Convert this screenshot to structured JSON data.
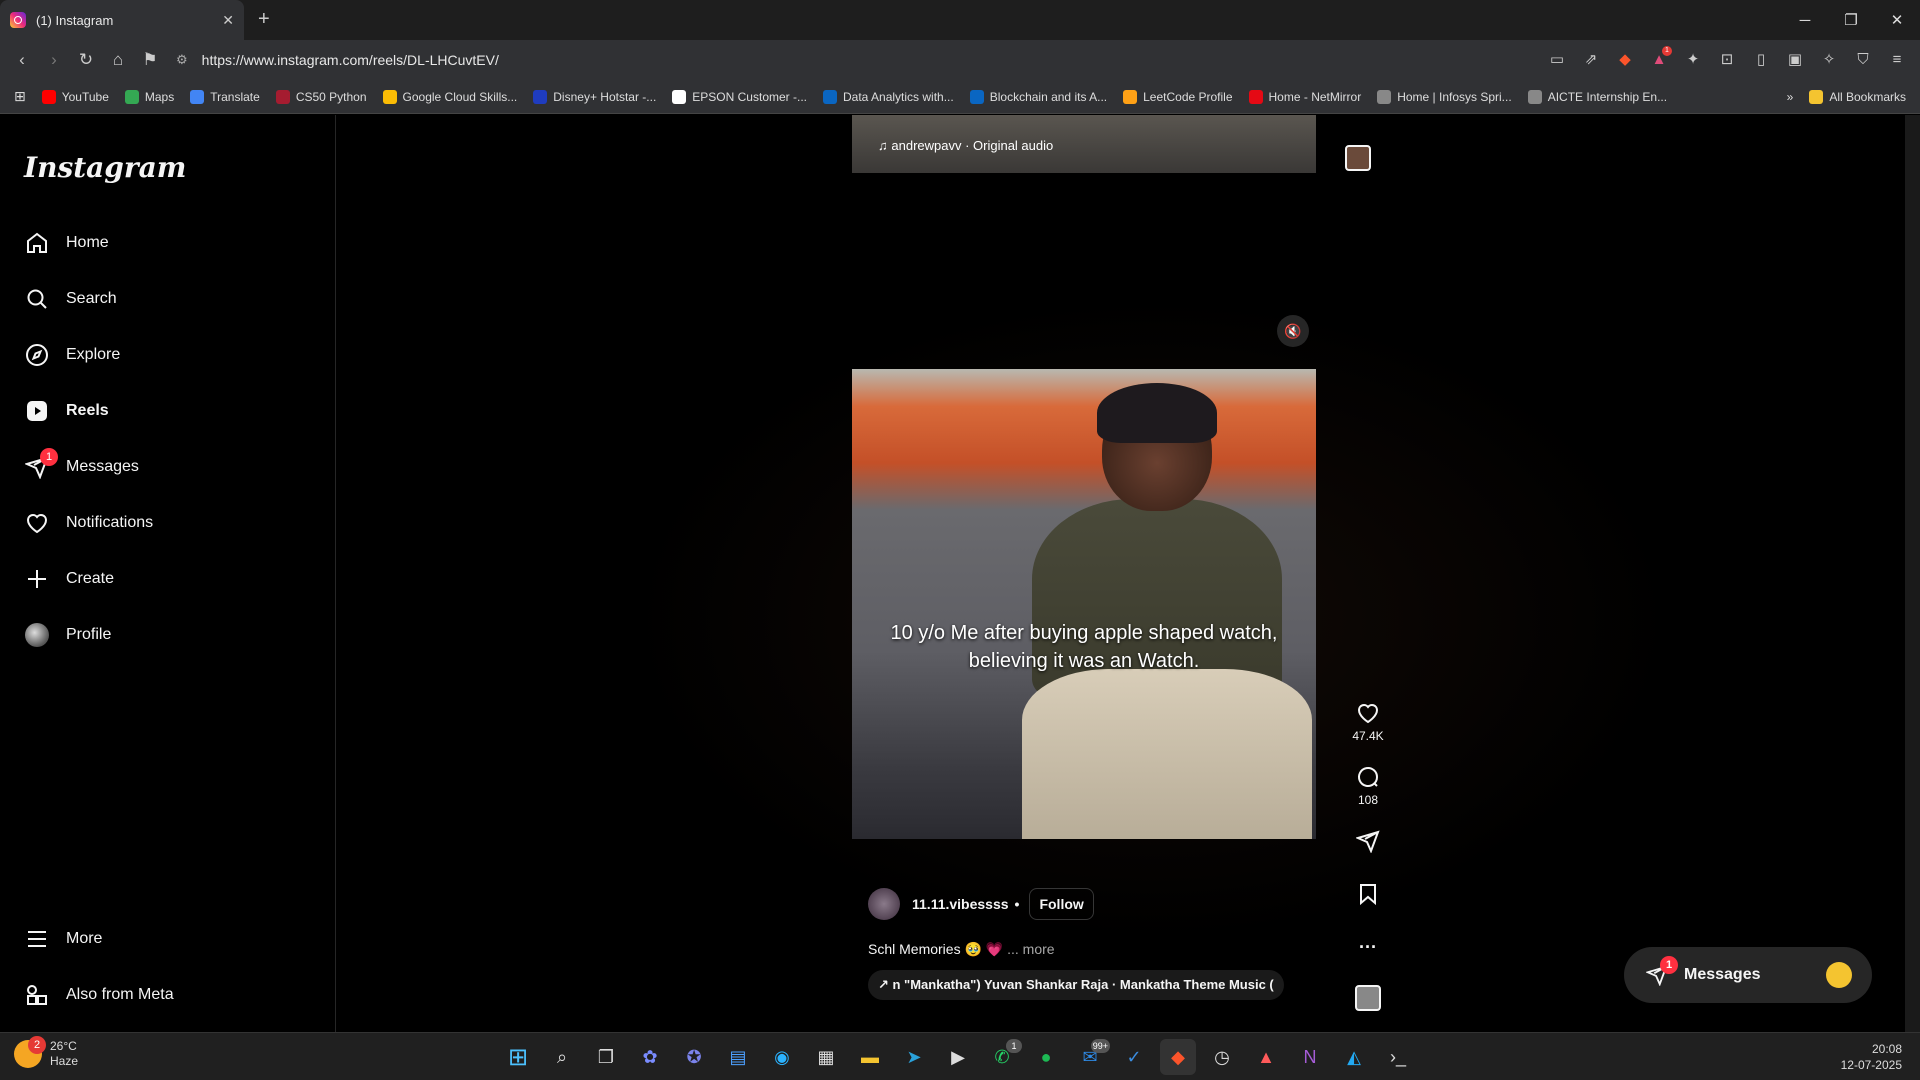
{
  "browser": {
    "tab_title": "(1) Instagram",
    "url": "https://www.instagram.com/reels/DL-LHCuvtEV/",
    "bookmarks": [
      {
        "label": "YouTube",
        "color": "#ff0000"
      },
      {
        "label": "Maps",
        "color": "#34a853"
      },
      {
        "label": "Translate",
        "color": "#4285f4"
      },
      {
        "label": "CS50 Python",
        "color": "#a51c30"
      },
      {
        "label": "Google Cloud Skills...",
        "color": "#fbbc05"
      },
      {
        "label": "Disney+ Hotstar -...",
        "color": "#1f3cbf"
      },
      {
        "label": "EPSON Customer -...",
        "color": "#ffffff"
      },
      {
        "label": "Data Analytics with...",
        "color": "#0a66c2"
      },
      {
        "label": "Blockchain and its A...",
        "color": "#0a66c2"
      },
      {
        "label": "LeetCode Profile",
        "color": "#ffa116"
      },
      {
        "label": "Home - NetMirror",
        "color": "#e50914"
      },
      {
        "label": "Home | Infosys Spri...",
        "color": "#888888"
      },
      {
        "label": "AICTE Internship En...",
        "color": "#888888"
      }
    ],
    "all_bookmarks": "All Bookmarks"
  },
  "instagram": {
    "logo": "Instagram",
    "nav": [
      {
        "label": "Home",
        "icon": "home-icon"
      },
      {
        "label": "Search",
        "icon": "search-icon"
      },
      {
        "label": "Explore",
        "icon": "compass-icon"
      },
      {
        "label": "Reels",
        "icon": "reels-icon"
      },
      {
        "label": "Messages",
        "icon": "messenger-icon",
        "badge": "1"
      },
      {
        "label": "Notifications",
        "icon": "heart-icon"
      },
      {
        "label": "Create",
        "icon": "plus-icon"
      },
      {
        "label": "Profile",
        "icon": "avatar-icon"
      }
    ],
    "more": "More",
    "also_from_meta": "Also from Meta",
    "prev_reel_audio": "andrewpavv · Original audio",
    "reel": {
      "overlay_text_1": "10 y/o Me after buying apple shaped watch,",
      "overlay_text_2": "believing it was an",
      "overlay_text_3": "Watch.",
      "likes": "47.4K",
      "comments": "108",
      "author": "11.11.vibessss",
      "separator": "•",
      "follow": "Follow",
      "description": "Schl Memories 🥹 💗",
      "more": "... more",
      "music": "↗ n \"Mankatha\")  Yuvan Shankar Raja · Mankatha Theme Music ("
    },
    "messages_float": {
      "label": "Messages",
      "badge": "1"
    }
  },
  "taskbar": {
    "temp": "26°C",
    "weather": "Haze",
    "weather_badge": "2",
    "time": "20:08",
    "date": "12-07-2025",
    "whatsapp_badge": "1",
    "outlook_badge": "99+"
  }
}
